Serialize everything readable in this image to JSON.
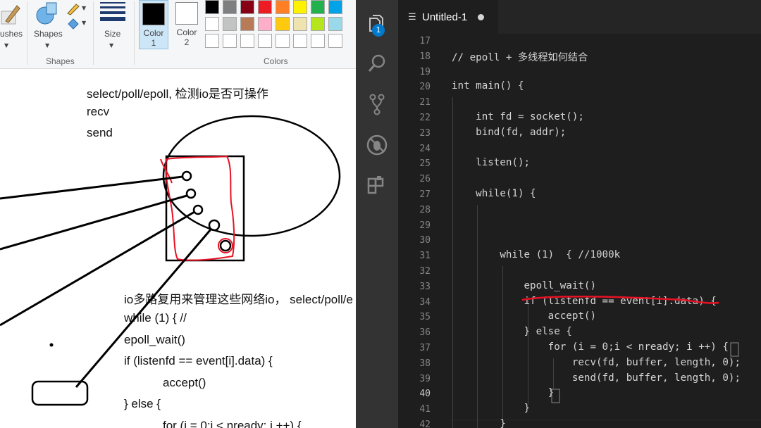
{
  "paint": {
    "ribbon": {
      "brushes_label": "ushes",
      "shapes_label": "Shapes",
      "shapes_group": "Shapes",
      "size_label": "Size",
      "color1_label": "Color",
      "color1_num": "1",
      "color2_label": "Color",
      "color2_num": "2",
      "colors_group": "Colors",
      "color1_value": "#000000",
      "color2_value": "#ffffff",
      "palette_row1": [
        "#000000",
        "#7f7f7f",
        "#880015",
        "#ed1c24",
        "#ff7f27",
        "#fff200",
        "#22b14c",
        "#00a2e8"
      ],
      "palette_row2": [
        "#ffffff",
        "#c3c3c3",
        "#b97a57",
        "#ffaec9",
        "#ffc90e",
        "#efe4b0",
        "#b5e61d",
        "#99d9ea"
      ]
    },
    "canvas": {
      "text_top": [
        "select/poll/epoll, 检测io是否可操作",
        "recv",
        "send"
      ],
      "text_bottom": [
        "io多路复用来管理这些网络io， select/poll/e",
        "while (1)  { //",
        "epoll_wait()",
        "if (listenfd == event[i].data) {",
        "accept()",
        "} else {",
        "for (i = 0;i < nready; i ++) {"
      ]
    }
  },
  "vscode": {
    "tab_title": "Untitled-1",
    "badge": "1",
    "active_line": "40",
    "colors": {
      "keyword": "#d4d4d4",
      "text": "#d4d4d4",
      "gutter": "#858585",
      "bg": "#1e1e1e",
      "annotation": "#e81123"
    },
    "lines": [
      {
        "n": "17",
        "t": ""
      },
      {
        "n": "18",
        "t": "// epoll + 多线程如何结合"
      },
      {
        "n": "19",
        "t": ""
      },
      {
        "n": "20",
        "t": "int main() {"
      },
      {
        "n": "21",
        "t": ""
      },
      {
        "n": "22",
        "t": "    int fd = socket();"
      },
      {
        "n": "23",
        "t": "    bind(fd, addr);"
      },
      {
        "n": "24",
        "t": ""
      },
      {
        "n": "25",
        "t": "    listen();"
      },
      {
        "n": "26",
        "t": ""
      },
      {
        "n": "27",
        "t": "    while(1) {"
      },
      {
        "n": "28",
        "t": ""
      },
      {
        "n": "29",
        "t": ""
      },
      {
        "n": "30",
        "t": ""
      },
      {
        "n": "31",
        "t": "        while (1)  { //1000k"
      },
      {
        "n": "32",
        "t": ""
      },
      {
        "n": "33",
        "t": "            epoll_wait()"
      },
      {
        "n": "34",
        "t": "            if (listenfd == event[i].data) {"
      },
      {
        "n": "35",
        "t": "                accept()"
      },
      {
        "n": "36",
        "t": "            } else {"
      },
      {
        "n": "37",
        "t": "                for (i = 0;i < nready; i ++) {"
      },
      {
        "n": "38",
        "t": "                    recv(fd, buffer, length, 0);"
      },
      {
        "n": "39",
        "t": "                    send(fd, buffer, length, 0);"
      },
      {
        "n": "40",
        "t": "                }"
      },
      {
        "n": "41",
        "t": "            }"
      },
      {
        "n": "42",
        "t": "        }"
      }
    ]
  }
}
